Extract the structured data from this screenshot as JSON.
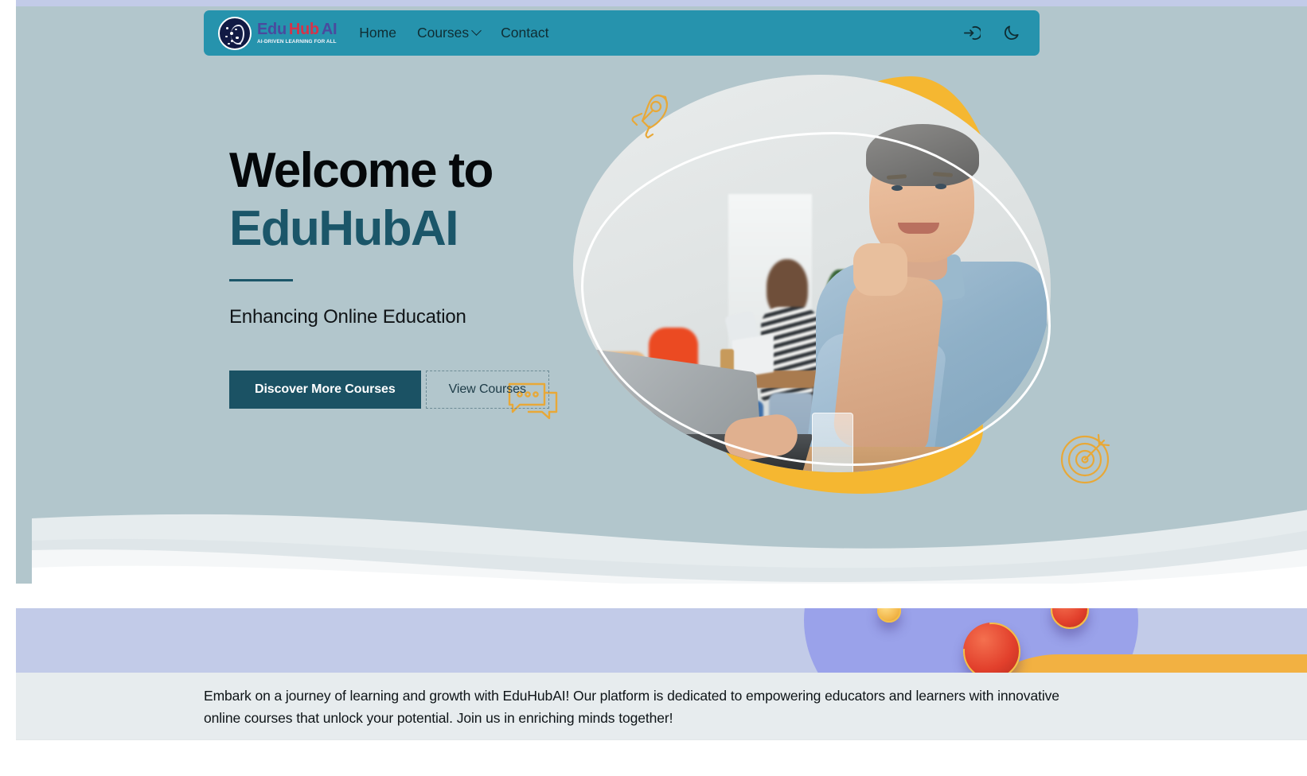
{
  "brand": {
    "edu": "Edu",
    "hub": "Hub",
    "ai": "AI",
    "tagline": "AI-DRIVEN LEARNING FOR ALL",
    "logo_icon": "ai-brain-network-icon"
  },
  "nav": {
    "links": [
      {
        "label": "Home",
        "has_caret": false
      },
      {
        "label": "Courses",
        "has_caret": true
      },
      {
        "label": "Contact",
        "has_caret": false
      }
    ],
    "actions": [
      {
        "name": "login-icon",
        "title": "Login"
      },
      {
        "name": "moon-icon",
        "title": "Dark mode"
      }
    ]
  },
  "hero": {
    "headline_line1": "Welcome to",
    "headline_line2": "EduHubAI",
    "subtitle": "Enhancing Online Education",
    "primary_cta": "Discover More Courses",
    "secondary_cta": "View Courses",
    "image_alt": "Man smiling at a laptop in a bright office",
    "decorations": [
      "rocket-icon",
      "target-icon",
      "chat-bubbles-icon"
    ]
  },
  "band": {
    "paragraph": "Embark on a journey of learning and growth with EduHubAI! Our platform is dedicated to empowering educators and learners with innovative online courses that unlock your potential. Join us in enriching minds together!"
  },
  "colors": {
    "navbar": "#2693ad",
    "hero_bg": "#b2c6cc",
    "accent_teal": "#1b5669",
    "accent_gold": "#e8a837",
    "band_lavender": "#c2cbe8",
    "band_orange": "#f2b142",
    "brand_red": "#d6334a",
    "brand_purple": "#4a4a9e"
  }
}
